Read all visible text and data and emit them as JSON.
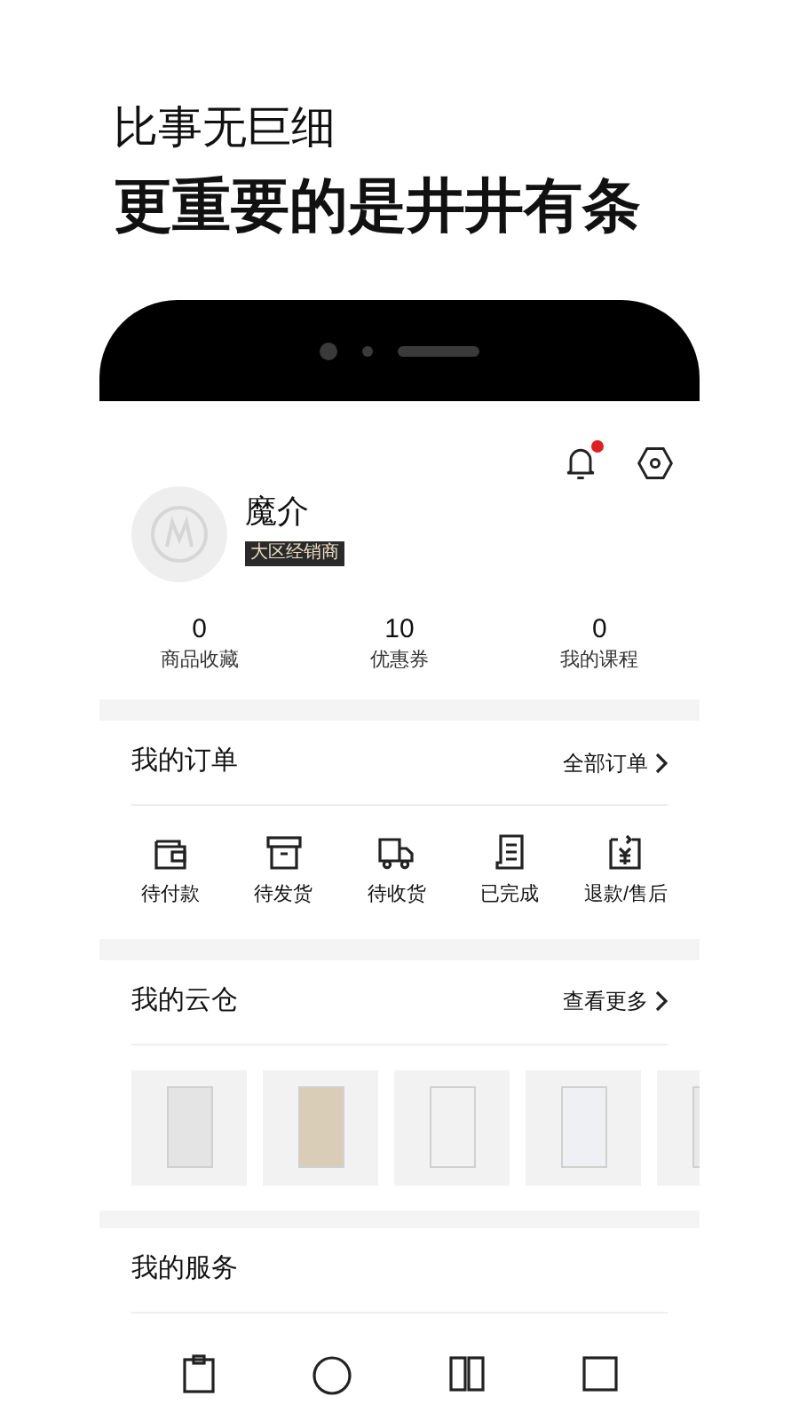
{
  "headline": {
    "subtitle": "比事无巨细",
    "title": "更重要的是井井有条"
  },
  "profile": {
    "notification_badge": true,
    "name": "魔介",
    "tag": "大区经销商",
    "stats": [
      {
        "value": "0",
        "label": "商品收藏"
      },
      {
        "value": "10",
        "label": "优惠券"
      },
      {
        "value": "0",
        "label": "我的课程"
      }
    ]
  },
  "orders": {
    "title": "我的订单",
    "link": "全部订单",
    "items": [
      {
        "kind": "wallet",
        "label": "待付款"
      },
      {
        "kind": "box",
        "label": "待发货"
      },
      {
        "kind": "truck",
        "label": "待收货"
      },
      {
        "kind": "receipt",
        "label": "已完成"
      },
      {
        "kind": "refund",
        "label": "退款/售后"
      }
    ]
  },
  "warehouse": {
    "title": "我的云仓",
    "link": "查看更多",
    "products": [
      {
        "color": "#e4e4e4"
      },
      {
        "color": "#d9cdb8"
      },
      {
        "color": "#f2f2f2"
      },
      {
        "color": "#eef0f4"
      },
      {
        "color": "#e8e8e8"
      }
    ]
  },
  "services": {
    "title": "我的服务",
    "items": [
      {
        "kind": "clipboard"
      },
      {
        "kind": "circle"
      },
      {
        "kind": "book"
      },
      {
        "kind": "square"
      }
    ]
  }
}
